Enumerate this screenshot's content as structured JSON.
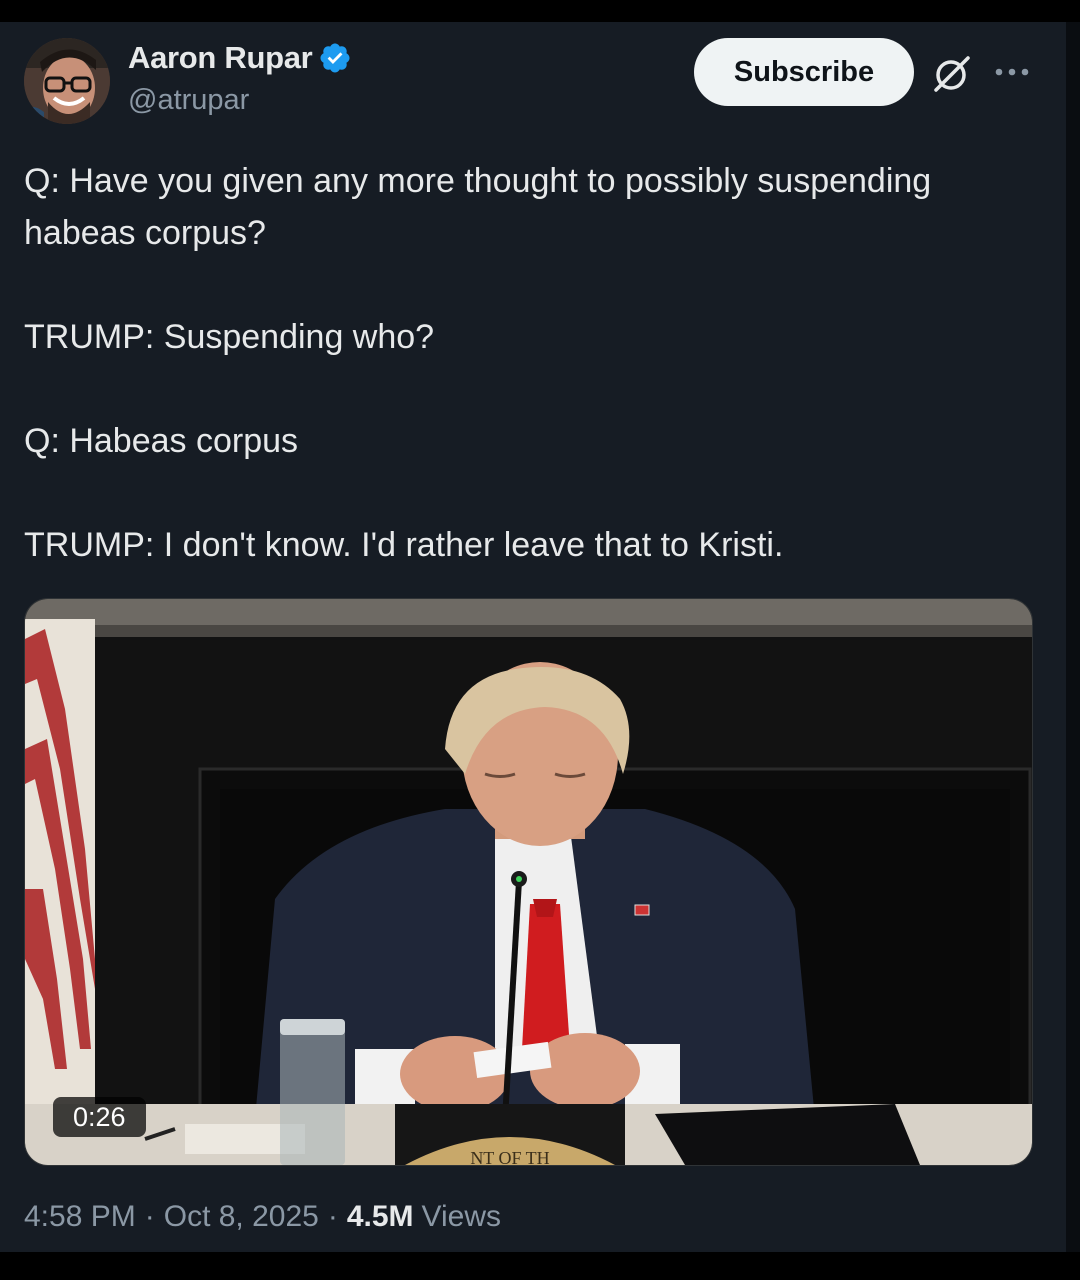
{
  "author": {
    "name": "Aaron Rupar",
    "handle": "@atrupar",
    "verified": true
  },
  "actions": {
    "subscribe_label": "Subscribe",
    "grok_icon": "grok-icon",
    "more_icon": "more-icon"
  },
  "tweet": {
    "lines": [
      "Q: Have you given any more thought to possibly suspending habeas corpus?",
      "TRUMP: Suspending who?",
      "Q: Habeas corpus",
      "TRUMP: I don't know. I'd rather leave that to Kristi."
    ]
  },
  "media": {
    "type": "video",
    "duration": "0:26",
    "seal_text": "NT OF TH"
  },
  "meta": {
    "time": "4:58 PM",
    "date": "Oct 8, 2025",
    "views_count": "4.5M",
    "views_label": "Views"
  },
  "colors": {
    "background": "#161c24",
    "text": "#e7e9ea",
    "secondary_text": "#8b98a5",
    "verified_blue": "#1d9bf0"
  }
}
